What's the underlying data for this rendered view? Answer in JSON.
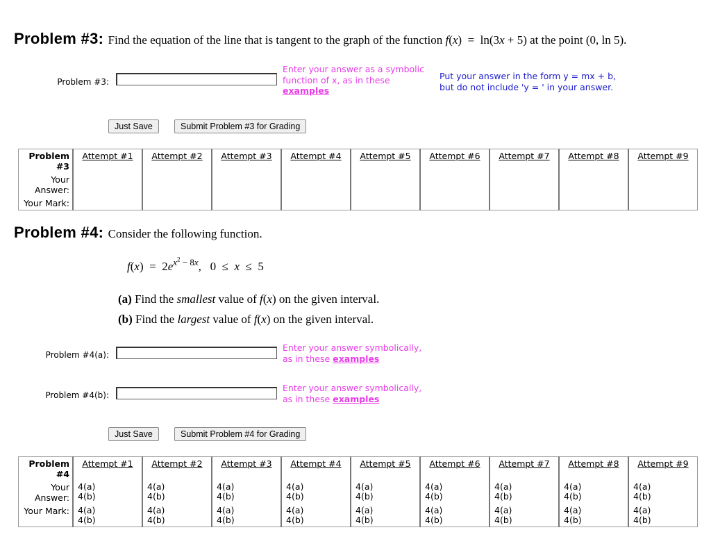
{
  "problem3": {
    "heading": "Problem #3:",
    "statement": "Find the equation of the line that is tangent to the graph of the function f(x) = ln(3x + 5) at the point (0, ln 5).",
    "input_label": "Problem #3:",
    "hint": "Enter your answer as a symbolic function of x, as in these",
    "hint_link": "examples",
    "note_line1": "Put your answer in the form y = mx + b,",
    "note_line2": "but do not include 'y = ' in your answer.",
    "save_label": "Just Save",
    "submit_label": "Submit Problem #3 for Grading",
    "table": {
      "title": "Problem #3",
      "answer_label": "Your Answer:",
      "mark_label": "Your Mark:",
      "attempts": [
        "Attempt #1",
        "Attempt #2",
        "Attempt #3",
        "Attempt #4",
        "Attempt #5",
        "Attempt #6",
        "Attempt #7",
        "Attempt #8",
        "Attempt #9"
      ]
    }
  },
  "problem4": {
    "heading": "Problem #4:",
    "statement": "Consider the following function.",
    "formula": "f(x) = 2e^(x² − 8x),   0 ≤ x ≤ 5",
    "part_a": "(a) Find the smallest value of f(x) on the given interval.",
    "part_b": "(b) Find the largest value of f(x) on the given interval.",
    "input_a_label": "Problem #4(a):",
    "input_b_label": "Problem #4(b):",
    "hint": "Enter your answer symbolically,",
    "hint2": "as in these",
    "hint_link": "examples",
    "save_label": "Just Save",
    "submit_label": "Submit Problem #4 for Grading",
    "table": {
      "title": "Problem #4",
      "answer_label": "Your Answer:",
      "mark_label": "Your Mark:",
      "part_a": "4(a)",
      "part_b": "4(b)",
      "attempts": [
        "Attempt #1",
        "Attempt #2",
        "Attempt #3",
        "Attempt #4",
        "Attempt #5",
        "Attempt #6",
        "Attempt #7",
        "Attempt #8",
        "Attempt #9"
      ]
    }
  },
  "colors": {
    "hint": "#e83ce8"
  }
}
